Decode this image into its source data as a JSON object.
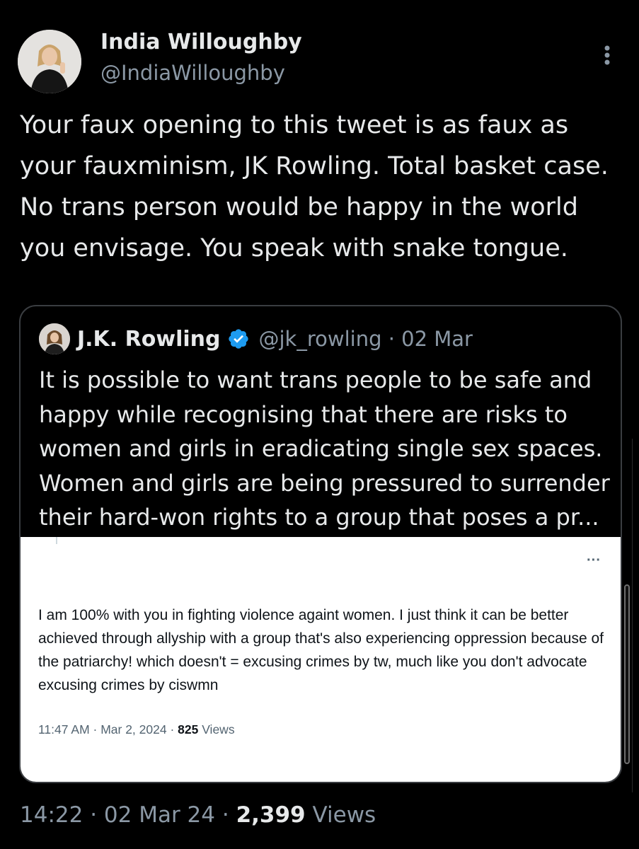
{
  "author": {
    "name": "India Willoughby",
    "handle": "@IndiaWilloughby",
    "avatar_icon": "profile-photo"
  },
  "tweet": {
    "text": "Your faux opening to this tweet is as faux as your fauxminism, JK Rowling. Total basket case. No trans person would be happy in the world you envisage. You speak with snake tongue."
  },
  "quoted": {
    "name": "J.K. Rowling",
    "verified_icon": "verified-badge-icon",
    "handle_date": "@jk_rowling · 02 Mar",
    "text": "It is possible to want trans people to be safe and happy while recognising that there are risks to women and girls in eradicating single sex spaces. Women and girls are being pressured to surrender their hard-won rights to a group that poses a pr...",
    "verified_color": "#1d9bf0"
  },
  "screenshot": {
    "more_glyph": "···",
    "text": "I am 100% with you in fighting violence againt women. I just think it can be better achieved through allyship with a group that's also experiencing oppression because of the patriarchy! which doesn't = excusing crimes by tw, much like you don't advocate excusing crimes by ciswmn",
    "time": "11:47 AM · Mar 2, 2024 · ",
    "views_count": "825",
    "views_label": " Views"
  },
  "footer": {
    "time_date": "14:22 · 02 Mar 24 · ",
    "views_count": "2,399",
    "views_label": " Views"
  }
}
